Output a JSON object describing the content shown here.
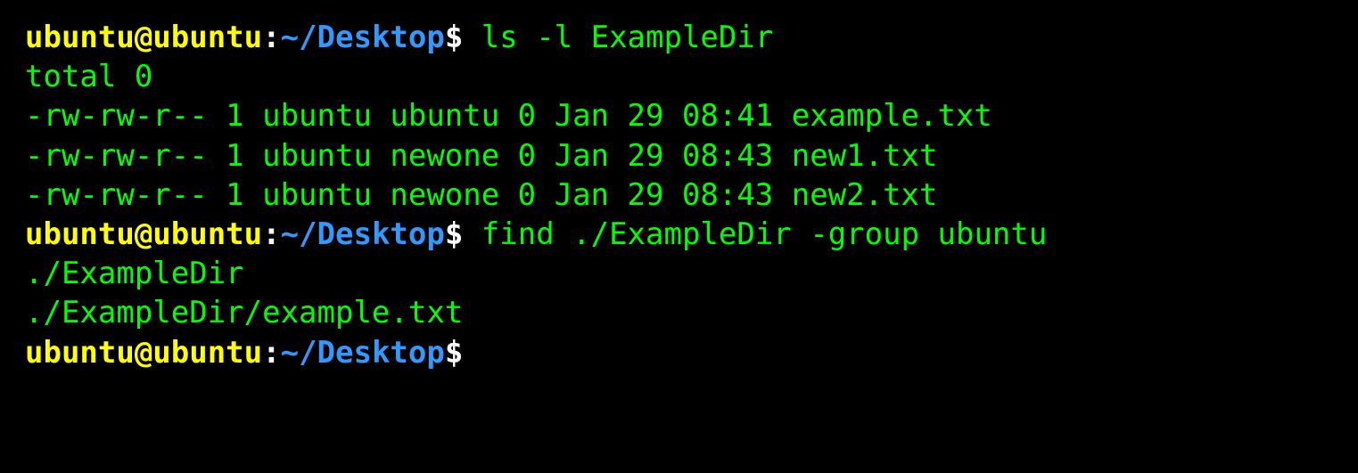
{
  "prompt": {
    "user_host": "ubuntu@ubuntu",
    "colon": ":",
    "path": "~/Desktop",
    "dollar": "$"
  },
  "session": [
    {
      "type": "command",
      "text": " ls -l ExampleDir"
    },
    {
      "type": "output",
      "text": "total 0"
    },
    {
      "type": "output",
      "text": "-rw-rw-r-- 1 ubuntu ubuntu 0 Jan 29 08:41 example.txt"
    },
    {
      "type": "output",
      "text": "-rw-rw-r-- 1 ubuntu newone 0 Jan 29 08:43 new1.txt"
    },
    {
      "type": "output",
      "text": "-rw-rw-r-- 1 ubuntu newone 0 Jan 29 08:43 new2.txt"
    },
    {
      "type": "command",
      "text": " find ./ExampleDir -group ubuntu"
    },
    {
      "type": "output",
      "text": "./ExampleDir"
    },
    {
      "type": "output",
      "text": "./ExampleDir/example.txt"
    },
    {
      "type": "command",
      "text": " "
    }
  ]
}
